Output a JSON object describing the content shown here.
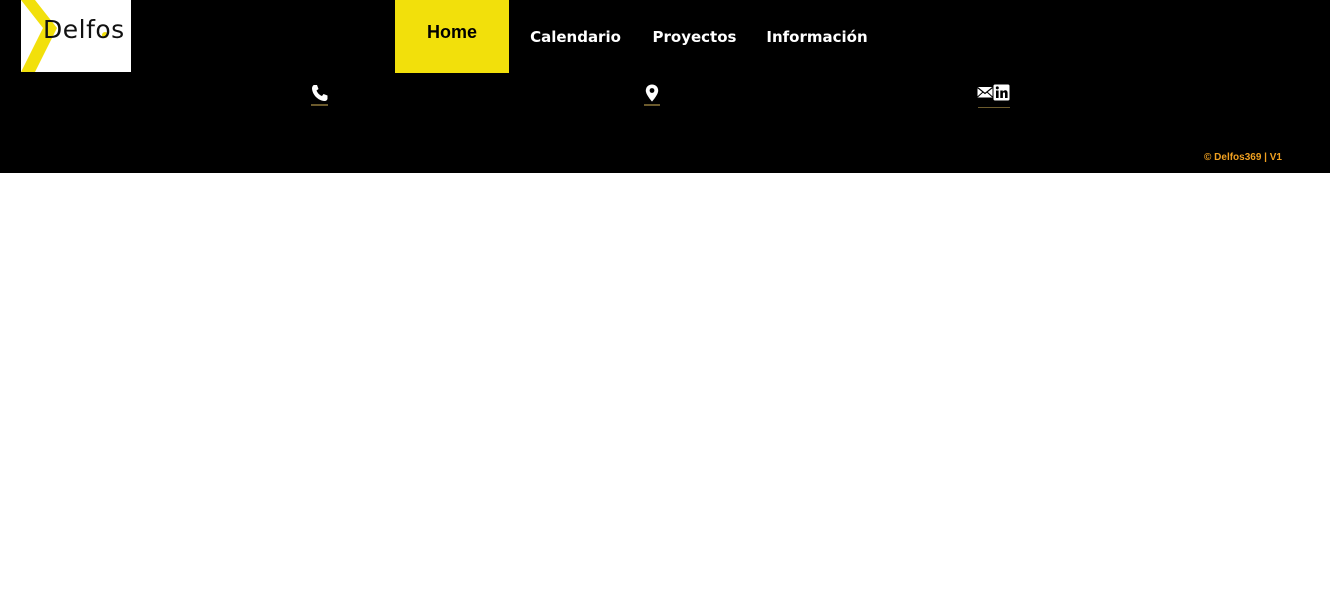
{
  "brand": {
    "logo_text": "Delfos",
    "accent_color": "#f2e00b"
  },
  "nav": {
    "items": [
      {
        "label": "Home",
        "active": true
      },
      {
        "label": "Calendario",
        "active": false
      },
      {
        "label": "Proyectos",
        "active": false
      },
      {
        "label": "Información",
        "active": false
      }
    ]
  },
  "contact_icons": {
    "phone": "phone-icon",
    "location": "location-pin-icon",
    "email": "email-icon",
    "linkedin": "linkedin-icon"
  },
  "footer": {
    "copyright": "© Delfos369 | V1",
    "copyright_color": "#f0a020"
  }
}
